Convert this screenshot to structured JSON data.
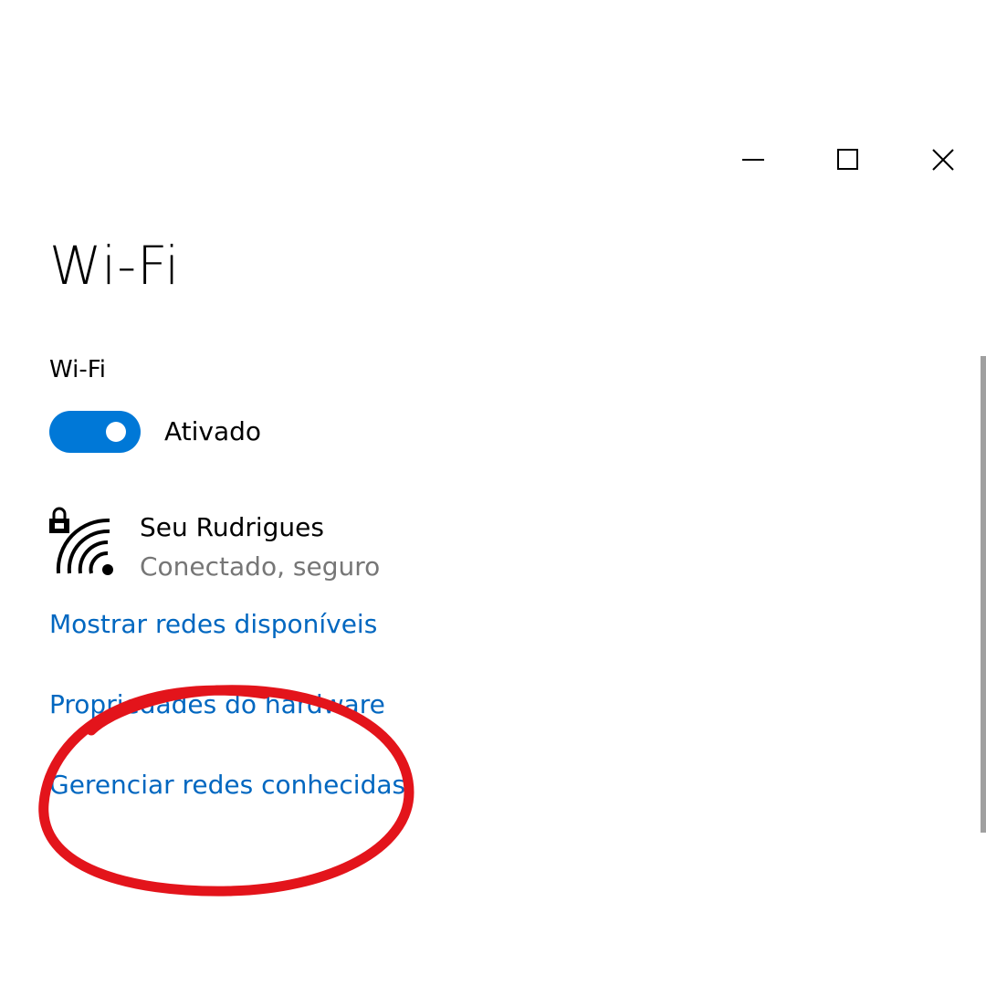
{
  "window": {
    "controls": {
      "minimize_icon": "minimize-icon",
      "maximize_icon": "maximize-icon",
      "close_icon": "close-icon"
    }
  },
  "page": {
    "title": "Wi-Fi"
  },
  "wifi_toggle": {
    "section_label": "Wi-Fi",
    "state_label": "Ativado",
    "on": true,
    "accent_color": "#0078d7"
  },
  "network": {
    "icon": "wifi-secured-icon",
    "name": "Seu Rudrigues",
    "status": "Conectado, seguro"
  },
  "links": {
    "show_networks": "Mostrar redes disponíveis",
    "hardware_properties": "Propriedades do hardware",
    "manage_known_networks": "Gerenciar redes conhecidas",
    "color": "#0067c0"
  },
  "annotation": {
    "color": "#e3141b",
    "shape": "hand-drawn-ellipse"
  }
}
